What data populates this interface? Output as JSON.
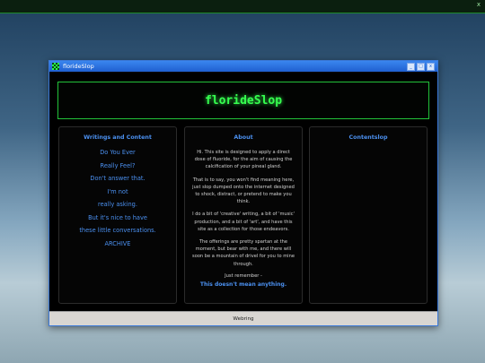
{
  "topbar": {
    "close_glyph": "x"
  },
  "window": {
    "title": "florideSlop",
    "icon": "checker-icon",
    "buttons": {
      "minimize": "_",
      "maximize": "□",
      "close": "x"
    }
  },
  "header": {
    "title": "florideSlop"
  },
  "left_panel": {
    "heading": "Writings and Content",
    "items": [
      "Do You Ever",
      "Really Feel?",
      "Don't answer that.",
      "I'm not",
      "really asking.",
      "But it's nice to have",
      "these little conversations.",
      "ARCHIVE"
    ]
  },
  "middle_panel": {
    "heading": "About",
    "paragraphs": [
      "Hi. This site is designed to apply a direct dose of fluoride, for the aim of causing the calcification of your pineal gland.",
      "That is to say, you won't find meaning here, just slop dumped onto the internet designed to shock, distract, or pretend to make you think.",
      "I do a bit of 'creative' writing, a bit of 'music' production, and a bit of 'art', and have this site as a collection for those endeavors.",
      "The offerings are pretty spartan at the moment, but bear with me, and there will soon be a mountain of drivel for you to mine through."
    ],
    "remember": "Just remember -",
    "tagline": "This doesn't mean anything."
  },
  "right_panel": {
    "heading": "Contentslop"
  },
  "footer": {
    "label": "Webring"
  },
  "colors": {
    "accent": "#4b90f0",
    "green": "#36ff4f",
    "titlebar": "#1f5fd0"
  }
}
